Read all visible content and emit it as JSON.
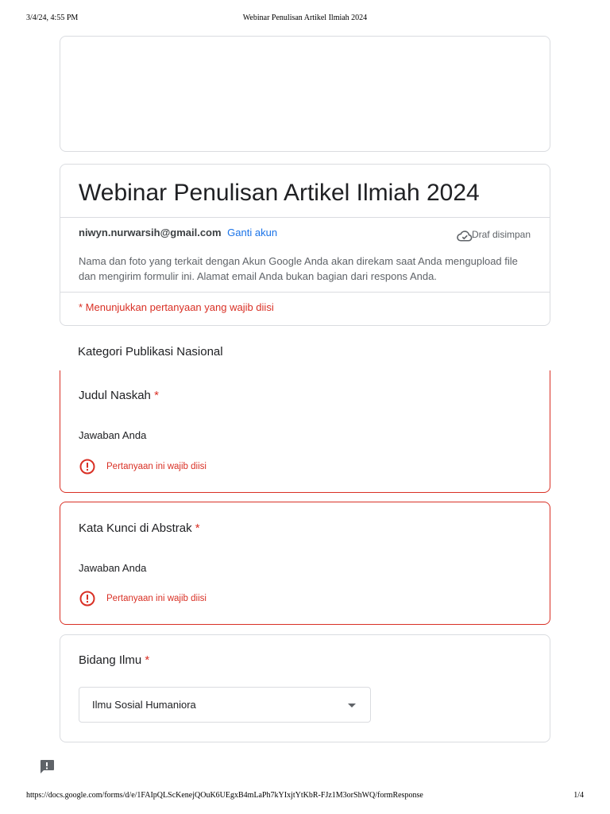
{
  "print": {
    "timestamp": "3/4/24, 4:55 PM",
    "title": "Webinar Penulisan Artikel Ilmiah 2024",
    "url": "https://docs.google.com/forms/d/e/1FAIpQLScKenejQOuK6UEgxB4mLaPh7kYIxjtYtKbR-FJz1M3orShWQ/formResponse",
    "page": "1/4"
  },
  "form": {
    "title": "Webinar Penulisan Artikel Ilmiah 2024",
    "account_email": "niwyn.nurwarsih@gmail.com",
    "switch_account": "Ganti akun",
    "draft_status": "Draf disimpan",
    "notice": "Nama dan foto yang terkait dengan Akun Google Anda akan direkam saat Anda mengupload file dan mengirim formulir ini. Alamat email Anda bukan bagian dari respons Anda.",
    "required_note": "* Menunjukkan pertanyaan yang wajib diisi"
  },
  "section": {
    "title": "Kategori Publikasi Nasional"
  },
  "questions": [
    {
      "title": "Judul Naskah",
      "required": "*",
      "answer_placeholder": "Jawaban Anda",
      "error": "Pertanyaan ini wajib diisi"
    },
    {
      "title": "Kata Kunci di Abstrak",
      "required": "*",
      "answer_placeholder": "Jawaban Anda",
      "error": "Pertanyaan ini wajib diisi"
    },
    {
      "title": "Bidang Ilmu",
      "required": "*",
      "selected": "Ilmu Sosial Humaniora"
    }
  ],
  "icons": {
    "draft": "cloud-check-icon",
    "error": "error-circle-icon",
    "dropdown": "arrow-drop-down-icon",
    "feedback": "feedback-icon"
  },
  "colors": {
    "error": "#d93025",
    "link": "#1a73e8",
    "border": "#dadce0"
  }
}
